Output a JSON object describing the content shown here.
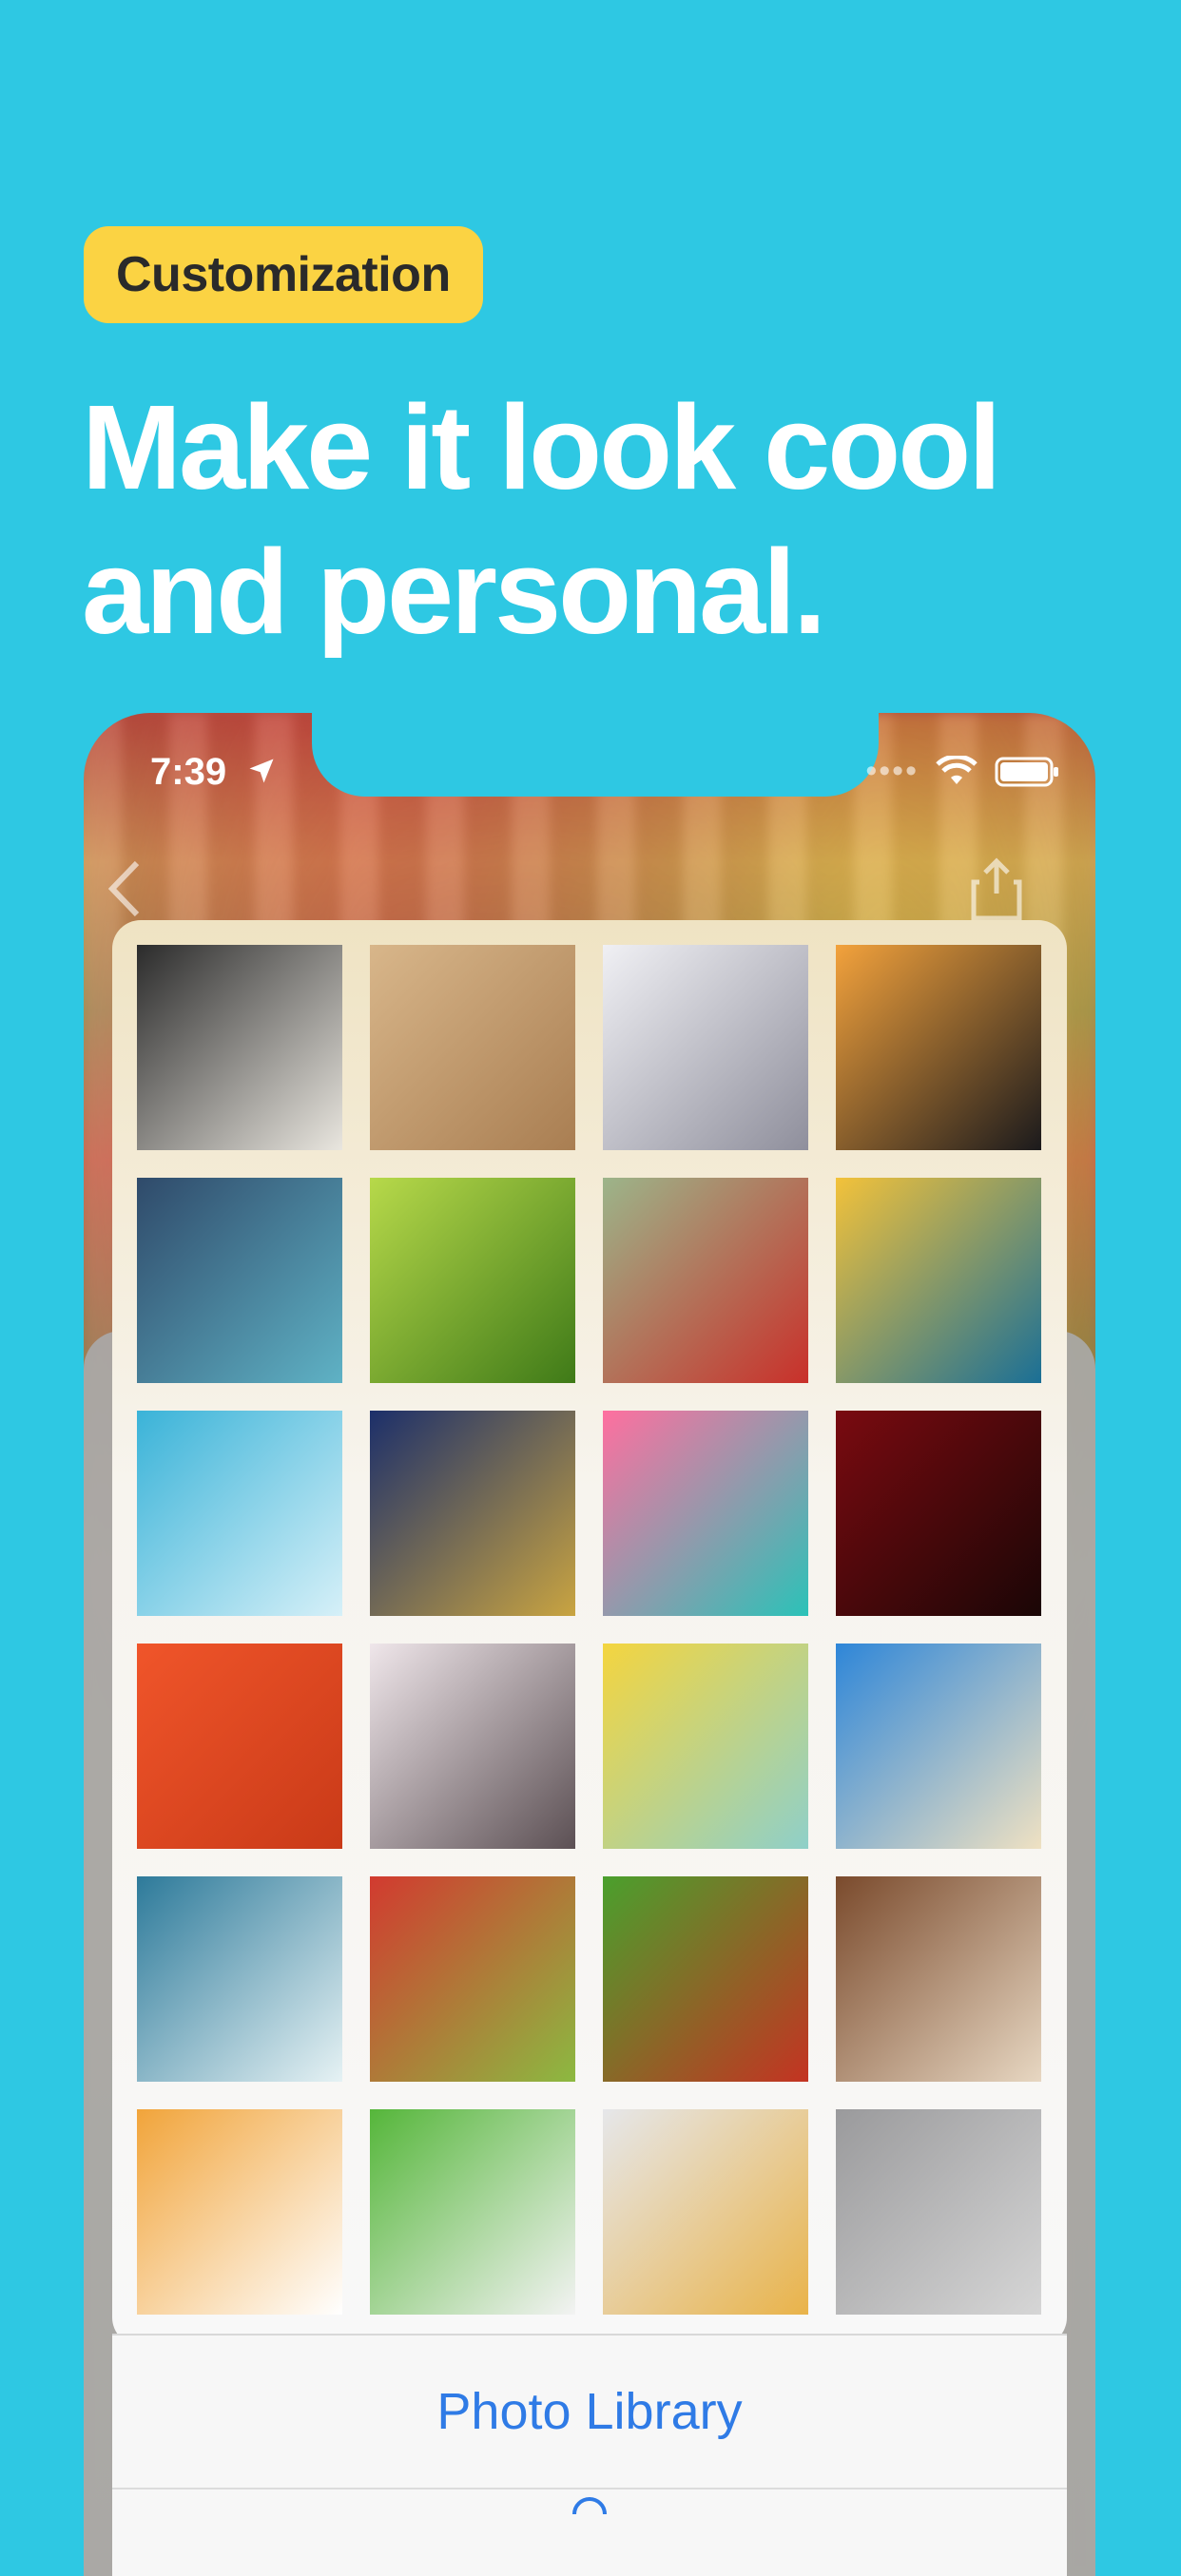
{
  "badge": {
    "label": "Customization"
  },
  "headline": {
    "line1": "Make it look cool",
    "line2": "and personal."
  },
  "status_bar": {
    "time": "7:39"
  },
  "photo_grid": {
    "tiles": [
      {
        "name": "black-white-wave-pavement",
        "colors": [
          "#2b2b2b",
          "#e9e6df"
        ]
      },
      {
        "name": "water-drops-on-sand",
        "colors": [
          "#d8b68a",
          "#a97e52"
        ]
      },
      {
        "name": "white-ice-splash",
        "colors": [
          "#f0f0f4",
          "#8f8f9c"
        ]
      },
      {
        "name": "sunset-over-hills",
        "colors": [
          "#f3a23c",
          "#1b1a1c"
        ]
      },
      {
        "name": "stormy-ocean-wave",
        "colors": [
          "#2f4a6a",
          "#5fb2c5"
        ]
      },
      {
        "name": "green-leaves-closeup",
        "colors": [
          "#b7d94a",
          "#3f7a18"
        ]
      },
      {
        "name": "red-poppies-field",
        "colors": [
          "#9cb58a",
          "#c9302a"
        ]
      },
      {
        "name": "blue-flowers-at-sunset",
        "colors": [
          "#f3c23a",
          "#1a6f96"
        ]
      },
      {
        "name": "blue-water-drops",
        "colors": [
          "#3ab3d8",
          "#d6f0f8"
        ]
      },
      {
        "name": "blue-gold-marble",
        "colors": [
          "#1c2f6a",
          "#c9a441"
        ]
      },
      {
        "name": "bananas-pink-teal",
        "colors": [
          "#ff6f9f",
          "#2bc2b8"
        ]
      },
      {
        "name": "red-wine-glass",
        "colors": [
          "#7a0a10",
          "#1a0606"
        ]
      },
      {
        "name": "orange-texture",
        "colors": [
          "#f0552a",
          "#c93a18"
        ]
      },
      {
        "name": "cherry-blossoms",
        "colors": [
          "#efe6ea",
          "#5c5054"
        ]
      },
      {
        "name": "sticky-notes",
        "colors": [
          "#f4d53f",
          "#8fd0c9"
        ]
      },
      {
        "name": "beach-umbrella",
        "colors": [
          "#2e86d8",
          "#efe1c2"
        ]
      },
      {
        "name": "ocean-wave-crash",
        "colors": [
          "#2d7a9a",
          "#e6f2f4"
        ]
      },
      {
        "name": "shopping-cart-vegetables",
        "colors": [
          "#d23a2f",
          "#8cb941"
        ]
      },
      {
        "name": "vegetable-basket",
        "colors": [
          "#4aa02d",
          "#c43322"
        ]
      },
      {
        "name": "gift-box-wooden-table",
        "colors": [
          "#7a4a2c",
          "#e7d7c2"
        ]
      },
      {
        "name": "sale-tags",
        "colors": [
          "#f1a43a",
          "#ffffff"
        ]
      },
      {
        "name": "colorful-shopping-bags",
        "colors": [
          "#55b63a",
          "#f3f3f3"
        ]
      },
      {
        "name": "paint-swatches-floorplan",
        "colors": [
          "#e6e7ea",
          "#e9b34a"
        ]
      },
      {
        "name": "living-room-interior",
        "colors": [
          "#9a9a9c",
          "#d6d6d6"
        ]
      }
    ]
  },
  "actions": {
    "photo_library": "Photo Library"
  },
  "colors": {
    "background": "#2ec8e3",
    "badge": "#fbd343",
    "headline_text": "#ffffff",
    "action_text": "#2f7be6"
  }
}
